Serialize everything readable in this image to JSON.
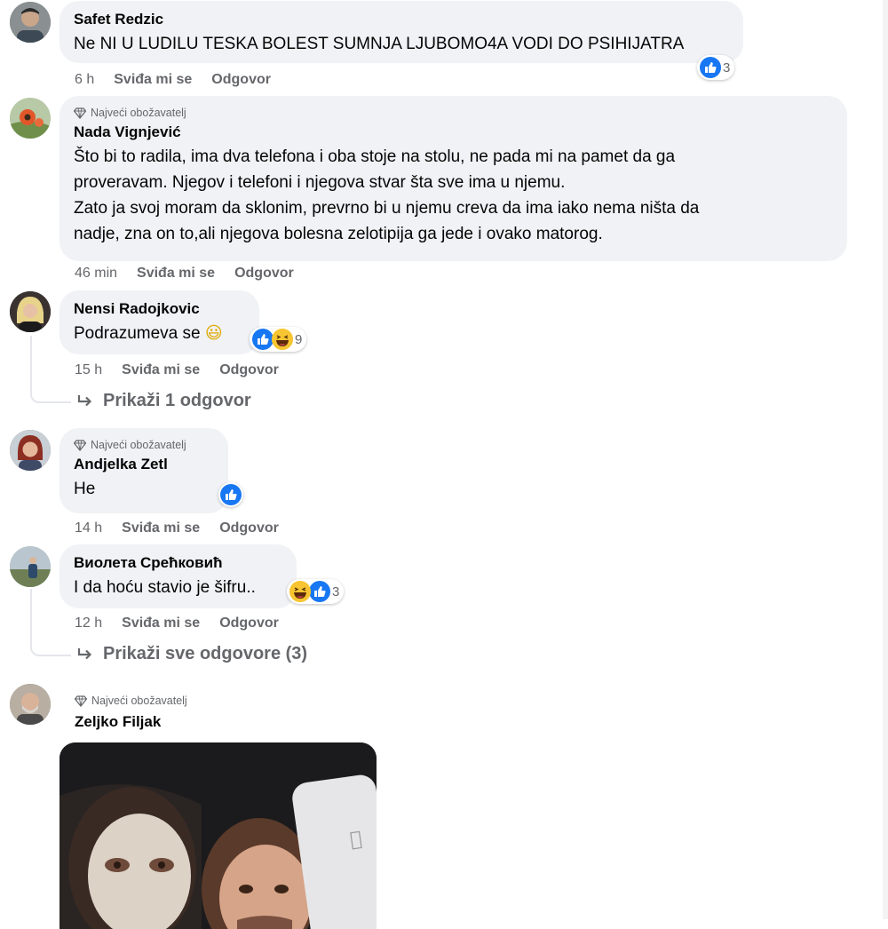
{
  "comments": [
    {
      "author": "Safet Redzic",
      "text": "Ne NI U LUDILU TESKA BOLEST SUMNJA LJUBOMO4A VODI DO PSIHIJATRA",
      "time": "6 h",
      "like_label": "Sviđa mi se",
      "reply_label": "Odgovor",
      "reaction_count": "3"
    },
    {
      "badge": "Najveći obožavatelj",
      "author": "Nada Vignjević",
      "text_lines": [
        "Što bi to radila, ima dva telefona i oba stoje na stolu, ne pada mi na pamet da ga",
        "proveravam. Njegov i telefoni i njegova stvar šta sve ima u njemu.",
        "Zato ja svoj moram da sklonim, prevrno bi u njemu creva da ima iako nema ništa da",
        "nadje, zna on to,ali njegova bolesna zelotipija ga jede i ovako matorog."
      ],
      "time": "46 min",
      "like_label": "Sviđa mi se",
      "reply_label": "Odgovor"
    },
    {
      "author": "Nensi Radojkovic",
      "text": "Podrazumeva se",
      "emoji": "😃",
      "time": "15 h",
      "like_label": "Sviđa mi se",
      "reply_label": "Odgovor",
      "reaction_count": "9",
      "replies_label": "Prikaži 1 odgovor"
    },
    {
      "badge": "Najveći obožavatelj",
      "author": "Andjelka Zetl",
      "text": "He",
      "time": "14 h",
      "like_label": "Sviđa mi se",
      "reply_label": "Odgovor"
    },
    {
      "author": "Виолета Срећковић",
      "text": "I da hoću stavio je šifru..",
      "time": "12 h",
      "like_label": "Sviđa mi se",
      "reply_label": "Odgovor",
      "reaction_count": "3",
      "replies_label": "Prikaži sve odgovore (3)"
    },
    {
      "badge": "Najveći obožavatelj",
      "author": "Zeljko Filjak"
    }
  ],
  "colors": {
    "bubble": "#f0f2f5",
    "meta": "#65676b",
    "like_blue": "#1877f2",
    "haha_yellow": "#f7c531"
  },
  "icons": [
    "like-reaction-icon",
    "haha-reaction-icon",
    "top-fan-badge-icon",
    "reply-arrow-icon"
  ]
}
